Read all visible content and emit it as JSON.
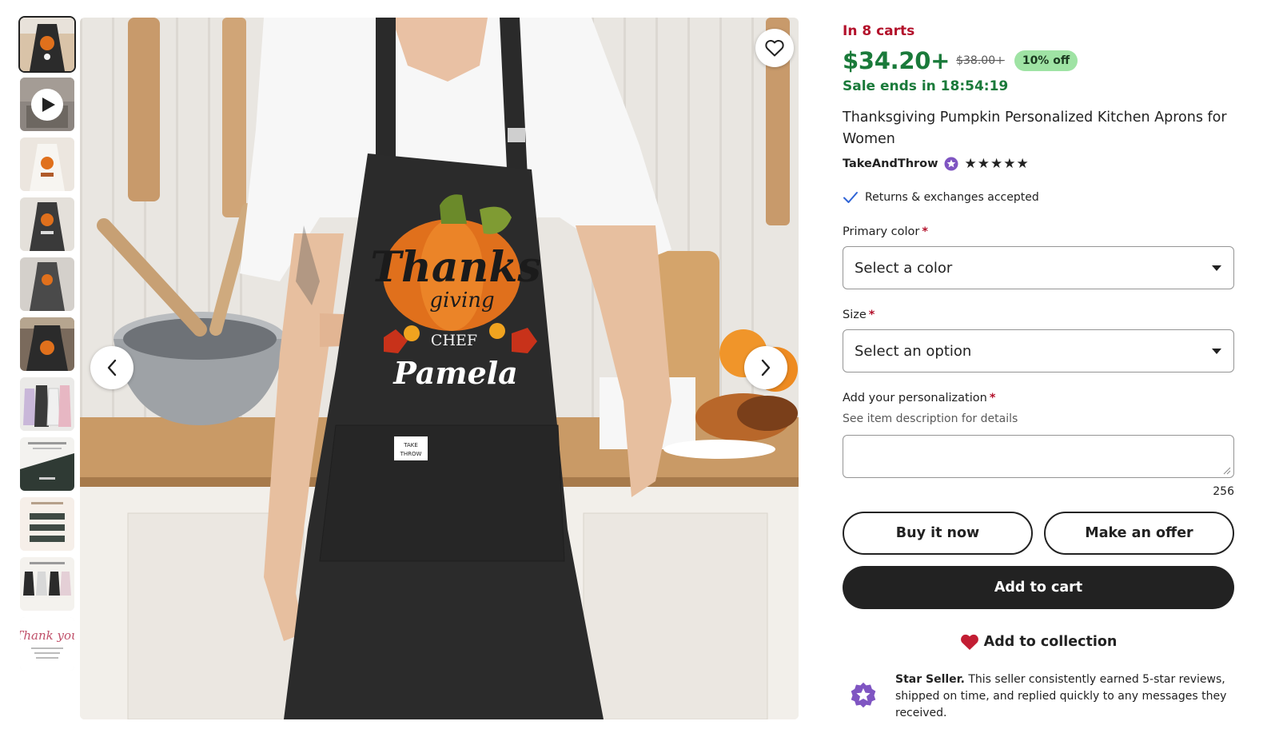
{
  "gallery": {
    "thumbnails": [
      {
        "name": "thumb-apron-main",
        "type": "image",
        "active": true
      },
      {
        "name": "thumb-video",
        "type": "video"
      },
      {
        "name": "thumb-apron-white",
        "type": "image"
      },
      {
        "name": "thumb-apron-model-2",
        "type": "image"
      },
      {
        "name": "thumb-apron-model-3",
        "type": "image"
      },
      {
        "name": "thumb-apron-model-4",
        "type": "image"
      },
      {
        "name": "thumb-apron-colors",
        "type": "image"
      },
      {
        "name": "thumb-size-chart",
        "type": "image"
      },
      {
        "name": "thumb-personalization-guide",
        "type": "image"
      },
      {
        "name": "thumb-apron-options",
        "type": "image"
      },
      {
        "name": "thumb-thank-you-card",
        "type": "image"
      }
    ],
    "main_image": {
      "apron_text": {
        "line1": "Thanks",
        "line2": "giving",
        "line3": "CHEF",
        "line4": "Pamela"
      },
      "pocket_label": {
        "line1": "TAKE",
        "line2": "THROW"
      }
    },
    "thank_you_thumb_text": "Thank you"
  },
  "listing": {
    "in_carts": "In 8 carts",
    "price": "$34.20+",
    "original_price": "$38.00+",
    "discount": "10% off",
    "sale_ends": "Sale ends in 18:54:19",
    "title": "Thanksgiving Pumpkin Personalized Kitchen Aprons for Women",
    "seller": "TakeAndThrow",
    "rating_stars": "★★★★★",
    "rating": 5,
    "returns": "Returns & exchanges accepted"
  },
  "options": {
    "primary_color": {
      "label": "Primary color",
      "required": "*",
      "value": "Select a color"
    },
    "size": {
      "label": "Size",
      "required": "*",
      "value": "Select an option"
    },
    "personalization": {
      "label": "Add your personalization",
      "required": "*",
      "help": "See item description for details",
      "value": "",
      "counter": "256"
    }
  },
  "actions": {
    "buy_now": "Buy it now",
    "make_offer": "Make an offer",
    "add_to_cart": "Add to cart",
    "add_to_collection": "Add to collection"
  },
  "star_seller": {
    "title": "Star Seller.",
    "text": " This seller consistently earned 5-star reviews, shipped on time, and replied quickly to any messages they received."
  },
  "colors": {
    "sale_red": "#b3112b",
    "price_green": "#1a7a3a",
    "discount_bg": "#9fe3a4",
    "star_purple": "#7f55c2",
    "heart_red": "#c21d33",
    "dark": "#222222"
  },
  "icons": {
    "favorite": "heart-outline-icon",
    "prev": "chevron-left-icon",
    "next": "chevron-right-icon",
    "play": "play-icon",
    "check": "check-icon",
    "collection": "heart-filled-icon",
    "star_seller": "star-seller-badge-icon"
  }
}
